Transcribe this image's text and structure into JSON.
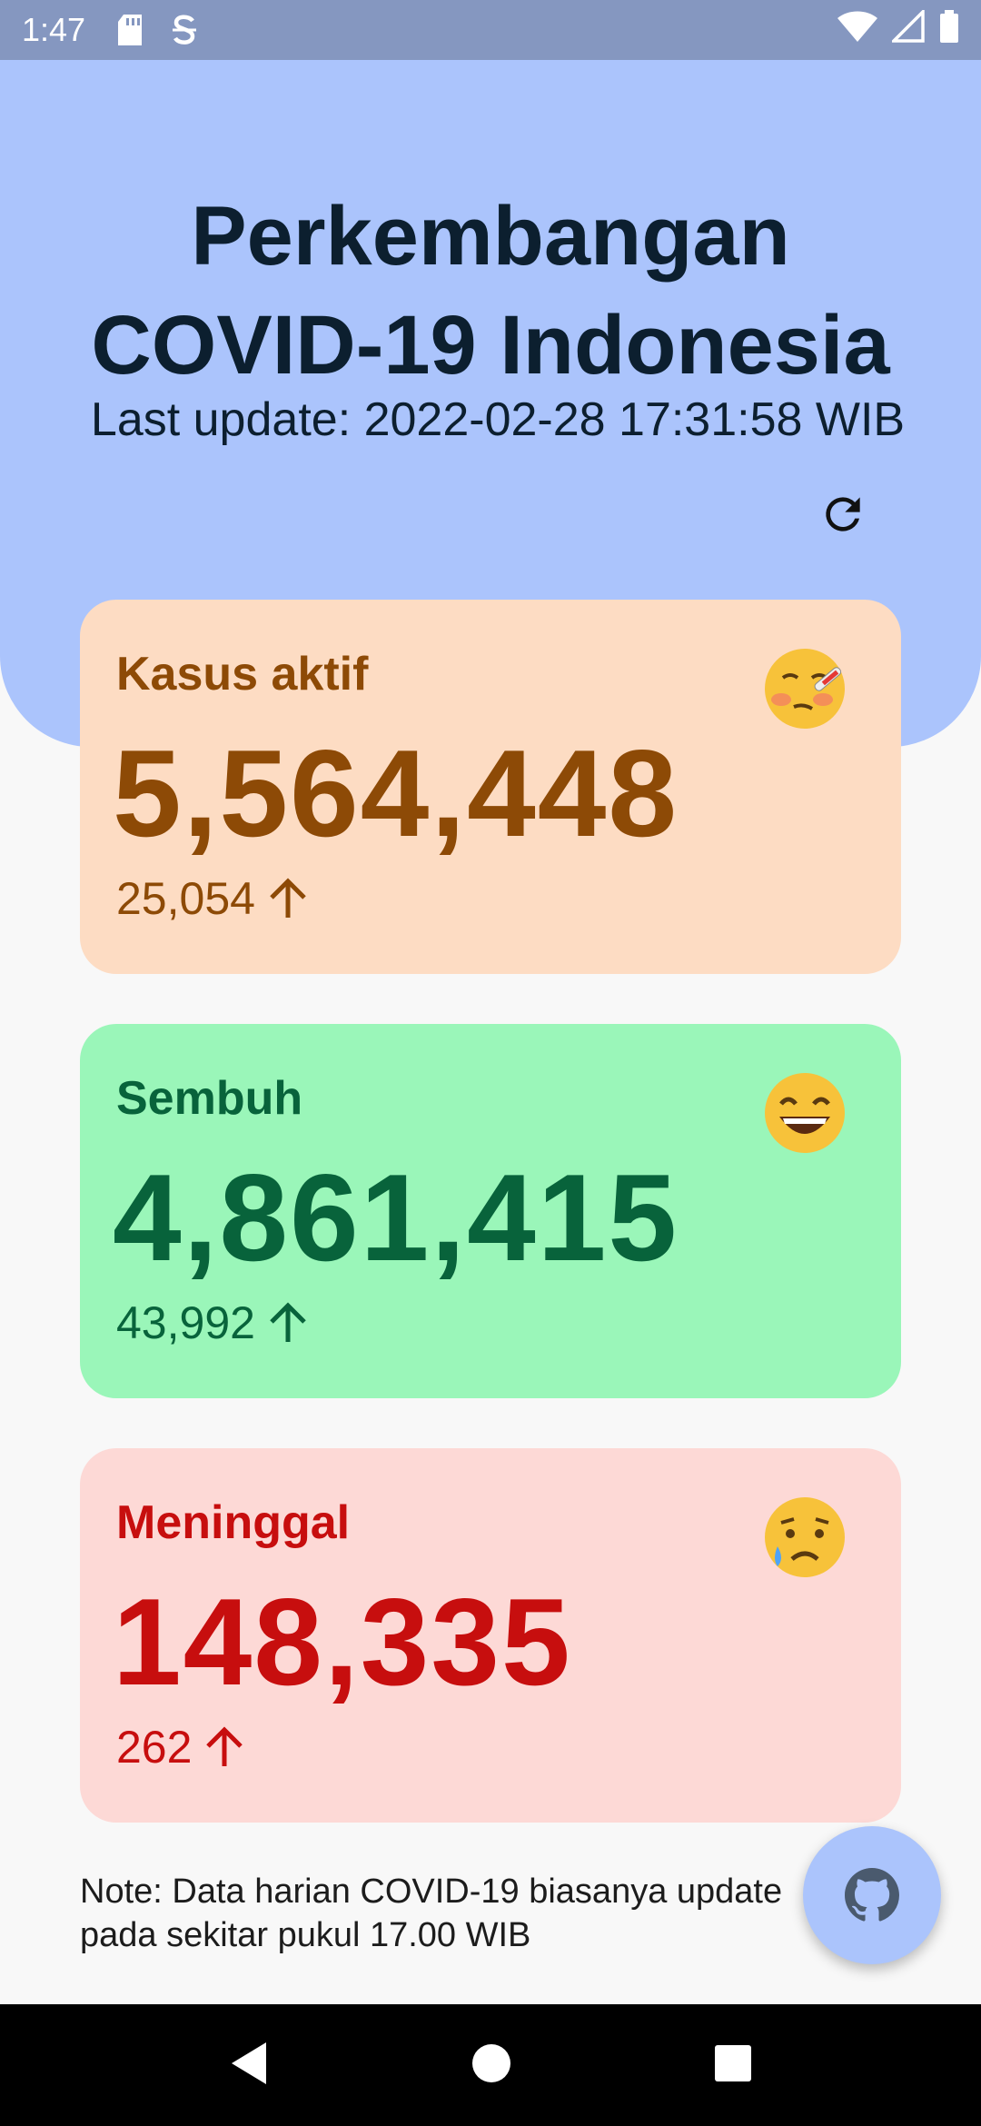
{
  "status_bar": {
    "time": "1:47",
    "icons": [
      "sd-card-icon",
      "s-app-icon",
      "wifi-icon",
      "signal-icon",
      "battery-icon"
    ]
  },
  "header": {
    "title_line1": "Perkembangan",
    "title_line2": "COVID-19 Indonesia",
    "last_update": "Last update: 2022-02-28 17:31:58 WIB",
    "refresh_icon": "refresh-icon"
  },
  "cards": {
    "active": {
      "label": "Kasus aktif",
      "value": "5,564,448",
      "delta": "25,054",
      "delta_direction": "up",
      "emoji": "face-with-thermometer",
      "bg_color": "#fddcc3",
      "text_color": "#8d4a06"
    },
    "recovered": {
      "label": "Sembuh",
      "value": "4,861,415",
      "delta": "43,992",
      "delta_direction": "up",
      "emoji": "grinning-face",
      "bg_color": "#9af6b9",
      "text_color": "#08633b"
    },
    "deaths": {
      "label": "Meninggal",
      "value": "148,335",
      "delta": "262",
      "delta_direction": "up",
      "emoji": "crying-face",
      "bg_color": "#fdd9d6",
      "text_color": "#c70e0e"
    }
  },
  "note": "Note: Data harian COVID-19 biasanya update pada sekitar pukul 17.00 WIB",
  "fab": {
    "icon": "github-icon"
  },
  "nav": {
    "back": "back-icon",
    "home": "home-icon",
    "recents": "recents-icon"
  },
  "colors": {
    "header_bg": "#abc4fc",
    "status_bar": "#8597c0",
    "page_bg": "#f8f8f8"
  }
}
